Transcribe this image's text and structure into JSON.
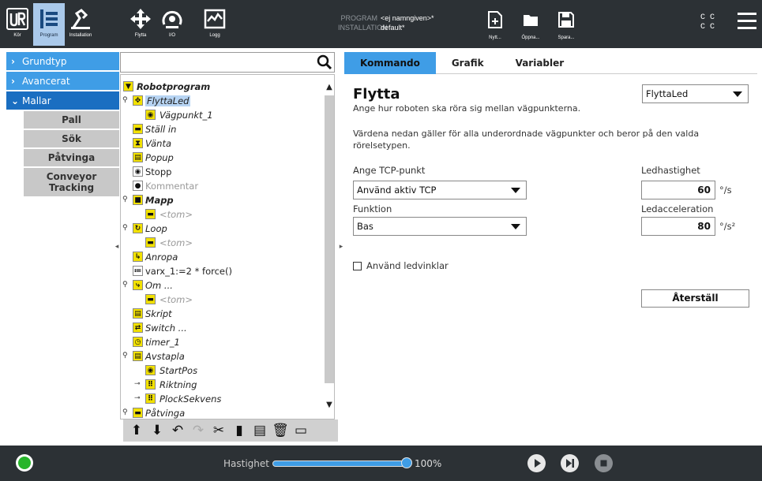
{
  "topbar": {
    "nav": [
      {
        "label": "Kör",
        "icon": "ur-logo-icon"
      },
      {
        "label": "Program",
        "icon": "program-icon"
      },
      {
        "label": "Installation",
        "icon": "installation-icon"
      },
      {
        "label": "Flytta",
        "icon": "move-icon"
      },
      {
        "label": "I/O",
        "icon": "io-icon"
      },
      {
        "label": "Logg",
        "icon": "log-icon"
      }
    ],
    "program_key": "PROGRAM",
    "program_value": "<ej namngiven>*",
    "installation_key": "INSTALLATION",
    "installation_value": "default*",
    "file_buttons": {
      "new": "Nytt...",
      "open": "Öppna...",
      "save": "Spara..."
    },
    "cc": [
      "C  C",
      "C  C"
    ]
  },
  "sidebar": {
    "categories": [
      {
        "label": "Grundtyp",
        "open": false
      },
      {
        "label": "Avancerat",
        "open": false
      },
      {
        "label": "Mallar",
        "open": true
      }
    ],
    "templates": [
      "Pall",
      "Sök",
      "Påtvinga",
      "Conveyor Tracking"
    ]
  },
  "tree": {
    "search_value": "",
    "nodes": [
      {
        "text": "Robotprogram",
        "icon": "▼"
      },
      {
        "text": "FlyttaLed",
        "icon": "✥"
      },
      {
        "text": "Vägpunkt_1",
        "icon": "◉"
      },
      {
        "text": "Ställ in",
        "icon": "▬"
      },
      {
        "text": "Vänta",
        "icon": "⧗"
      },
      {
        "text": "Popup",
        "icon": "▤"
      },
      {
        "text": "Stopp",
        "icon": "◉"
      },
      {
        "text": "Kommentar",
        "icon": "●"
      },
      {
        "text": "Mapp",
        "icon": "■"
      },
      {
        "text": "<tom>",
        "icon": "▬"
      },
      {
        "text": "Loop",
        "icon": "↻"
      },
      {
        "text": "<tom>",
        "icon": "▬"
      },
      {
        "text": "Anropa",
        "icon": "↳"
      },
      {
        "text": "varx_1:=2 * force()",
        "icon": "≔"
      },
      {
        "text": "Om ...",
        "icon": "⤷"
      },
      {
        "text": "<tom>",
        "icon": "▬"
      },
      {
        "text": "Skript",
        "icon": "▤"
      },
      {
        "text": "Switch ...",
        "icon": "⇄"
      },
      {
        "text": "timer_1",
        "icon": "◷"
      },
      {
        "text": "Avstapla",
        "icon": "▤"
      },
      {
        "text": "StartPos",
        "icon": "◉"
      },
      {
        "text": "Riktning",
        "icon": "⠿"
      },
      {
        "text": "PlockSekvens",
        "icon": "⠿"
      },
      {
        "text": "Påtvinga",
        "icon": "▬"
      }
    ]
  },
  "right": {
    "tabs": [
      "Kommando",
      "Grafik",
      "Variabler"
    ],
    "title": "Flytta",
    "subtitle": "Ange hur roboten ska röra sig mellan vägpunkterna.",
    "description": "Värdena nedan gäller för alla underordnade vägpunkter och beror på den valda rörelsetypen.",
    "move_type": "FlyttaLed",
    "tcp_label": "Ange TCP-punkt",
    "tcp_value": "Använd aktiv TCP",
    "function_label": "Funktion",
    "function_value": "Bas",
    "speed_label": "Ledhastighet",
    "speed_value": "60",
    "speed_unit": "°/s",
    "accel_label": "Ledacceleration",
    "accel_value": "80",
    "accel_unit": "°/s²",
    "checkbox_label": "Använd ledvinklar",
    "checkbox_checked": false,
    "reset_label": "Återställ"
  },
  "bottom": {
    "speed_label": "Hastighet",
    "speed_value": "100%",
    "speed_fraction": 1.0
  }
}
